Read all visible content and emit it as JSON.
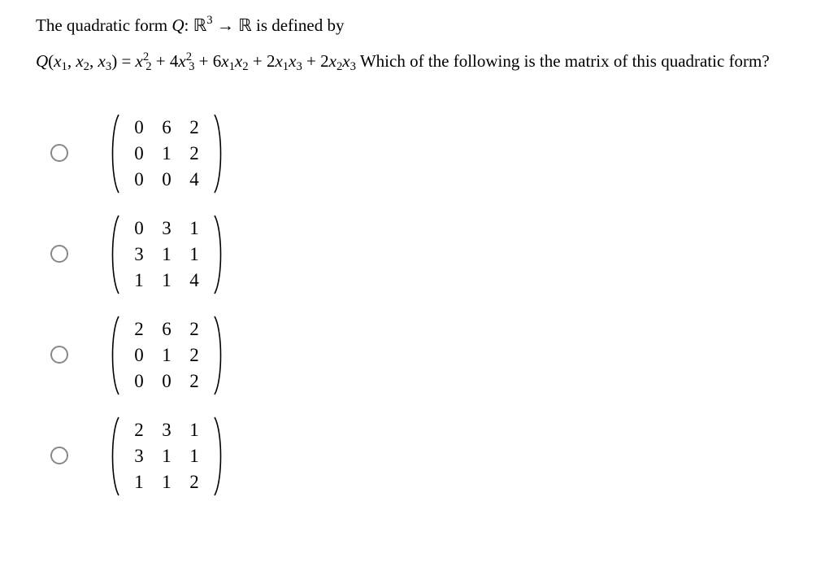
{
  "question": {
    "line1_pre": "The quadratic form ",
    "Q": "Q",
    "colon": ": ",
    "R": "ℝ",
    "exp3": "3",
    "arrow": " → ",
    "line1_post": " is defined by",
    "eq_lhs_Q": "Q",
    "eq_lhs_open": "(",
    "x": "x",
    "s1": "1",
    "s2": "2",
    "s3": "3",
    "comma": ", ",
    "eq_lhs_close": ")",
    "eq_eq": " = ",
    "sp": " ",
    "plus": " + ",
    "c4": "4",
    "c6": "6",
    "c2": "2",
    "tail": " Which of the following is the matrix of this quadratic form?"
  },
  "options": [
    {
      "rows": [
        [
          "0",
          "6",
          "2"
        ],
        [
          "0",
          "1",
          "2"
        ],
        [
          "0",
          "0",
          "4"
        ]
      ]
    },
    {
      "rows": [
        [
          "0",
          "3",
          "1"
        ],
        [
          "3",
          "1",
          "1"
        ],
        [
          "1",
          "1",
          "4"
        ]
      ]
    },
    {
      "rows": [
        [
          "2",
          "6",
          "2"
        ],
        [
          "0",
          "1",
          "2"
        ],
        [
          "0",
          "0",
          "2"
        ]
      ]
    },
    {
      "rows": [
        [
          "2",
          "3",
          "1"
        ],
        [
          "3",
          "1",
          "1"
        ],
        [
          "1",
          "1",
          "2"
        ]
      ]
    }
  ]
}
